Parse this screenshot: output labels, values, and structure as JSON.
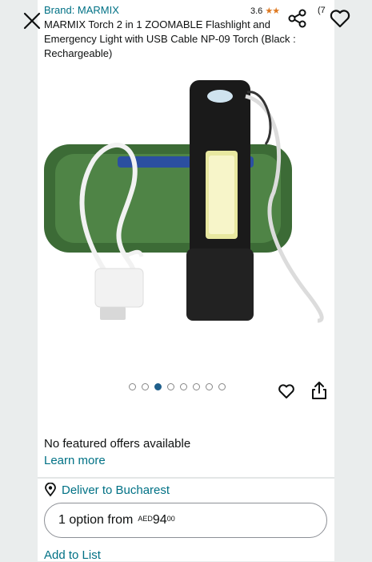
{
  "header": {
    "brand": "Brand: MARMIX",
    "rating_value": "3.6",
    "rating_stars": "★★",
    "rating_count": "(7",
    "title": "MARMIX Torch 2 in 1 ZOOMABLE Flashlight and Emergency Light with USB Cable NP-09 Torch (Black : Rechargeable)",
    "icons": [
      "close-icon",
      "share-icon",
      "heart-icon"
    ]
  },
  "gallery": {
    "image_count": 8,
    "active_index": 2
  },
  "actions": {
    "icons": [
      "heart-icon",
      "share-icon"
    ]
  },
  "offers": {
    "text": "No featured offers available",
    "learn_more": "Learn more"
  },
  "delivery": {
    "label": "Deliver to Bucharest",
    "icon": "location-pin-icon"
  },
  "buy_option": {
    "prefix": "1 option from",
    "currency": "AED",
    "whole": "94",
    "fraction": "00"
  },
  "list": {
    "add_label": "Add to List"
  },
  "colors": {
    "link": "#007185",
    "star": "#de7921",
    "active_dot": "#1f5f8b"
  }
}
